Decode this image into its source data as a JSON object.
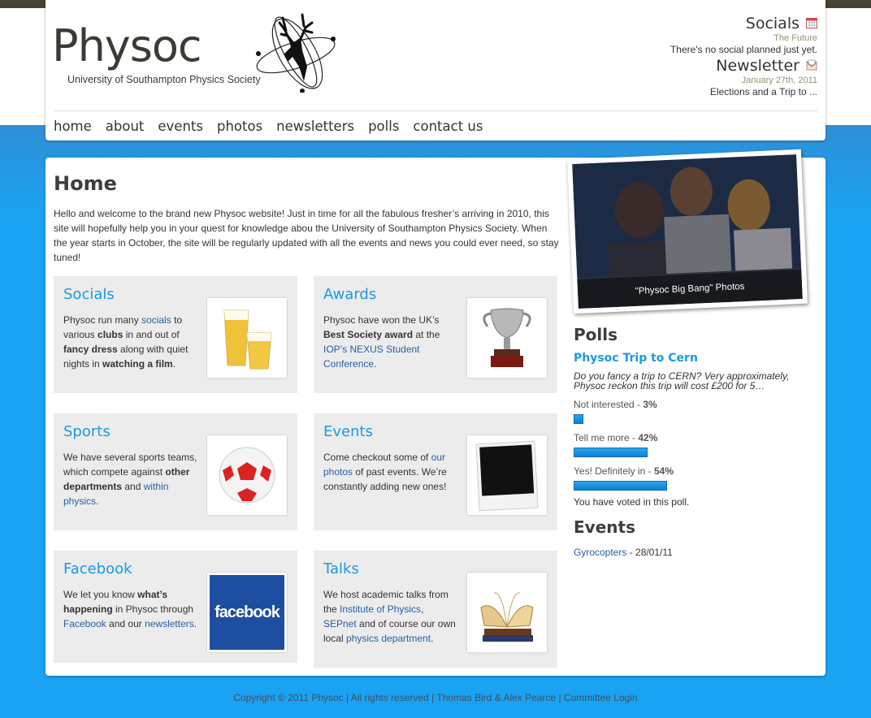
{
  "header": {
    "site_title": "Physoc",
    "site_subtitle": "University of Southampton Physics Society",
    "socials": {
      "title": "Socials",
      "date": "The Future",
      "text": "There's no social planned just yet.",
      "icon": "calendar-icon"
    },
    "newsletter": {
      "title": "Newsletter",
      "date": "January 27th, 2011",
      "text": "Elections and a Trip to ...",
      "icon": "newsletter-icon"
    }
  },
  "nav": [
    "home",
    "about",
    "events",
    "photos",
    "newsletters",
    "polls",
    "contact us"
  ],
  "main": {
    "title": "Home",
    "intro": "Hello and welcome to the brand new Physoc website! Just in time for all the fabulous fresher’s arriving in 2010, this site will hopefully help you in your quest for knowledge abou the University of Southampton Physics Society. When the year starts in October, the site will be regularly updated with all the events and news you could ever need, so stay tuned!"
  },
  "boxes": {
    "socials": {
      "title": "Socials",
      "t1": "Physoc run many ",
      "l1": "socials",
      "t2": " to various ",
      "b1": "clubs",
      "t3": " in and out of ",
      "b2": "fancy dress",
      "t4": " along with quiet nights in ",
      "b3": "watching a film",
      "t5": "."
    },
    "awards": {
      "title": "Awards",
      "t1": "Physoc have won the UK’s ",
      "b1": "Best Society award",
      "t2": " at the ",
      "l1": "IOP’s NEXUS Student Conference",
      "t3": "."
    },
    "sports": {
      "title": "Sports",
      "t1": "We have several sports teams, which compete against ",
      "b1": "other departments",
      "t2": " and ",
      "l1": "within physics",
      "t3": "."
    },
    "events": {
      "title": "Events",
      "t1": "Come checkout some of ",
      "l1": "our photos",
      "t2": " of past events. We’re constantly adding new ones!"
    },
    "facebook": {
      "title": "Facebook",
      "t1": "We let you know ",
      "b1": "what’s happening",
      "t2": " in Physoc through ",
      "l1": "Facebook",
      "t3": " and our ",
      "l2": "newsletters",
      "t4": ".",
      "thumb_text": "facebook"
    },
    "talks": {
      "title": "Talks",
      "t1": "We host academic talks from the ",
      "l1": "Institute of Physics",
      "t2": ", ",
      "l2": "SEPnet",
      "t3": " and of course our own local ",
      "l3": "physics department",
      "t4": "."
    }
  },
  "photo": {
    "caption": "\"Physoc Big Bang\" Photos"
  },
  "polls": {
    "heading": "Polls",
    "question": "Physoc Trip to Cern",
    "description": "Do you fancy a trip to CERN? Very approximately, Physoc reckon this trip will cost £200 for 5…",
    "options": [
      {
        "label": "Not interested - ",
        "pct": "3%",
        "value": 0.03
      },
      {
        "label": "Tell me more - ",
        "pct": "42%",
        "value": 0.42
      },
      {
        "label": "Yes! Definitely in - ",
        "pct": "54%",
        "value": 0.54
      }
    ],
    "voted": "You have voted in this poll."
  },
  "events_side": {
    "heading": "Events",
    "item_link": "Gyrocopters",
    "item_date": " - 28/01/11"
  },
  "footer": {
    "copyright": "Copyright © 2011 Physoc | All rights reserved | ",
    "authors": "Thomas Bird & Alex Pearce",
    "sep": " | ",
    "login": "Committee Login"
  },
  "colors": {
    "accent": "#1a9ae6",
    "link": "#2560a6",
    "background": "#1aa3f2",
    "box": "#ececec"
  }
}
